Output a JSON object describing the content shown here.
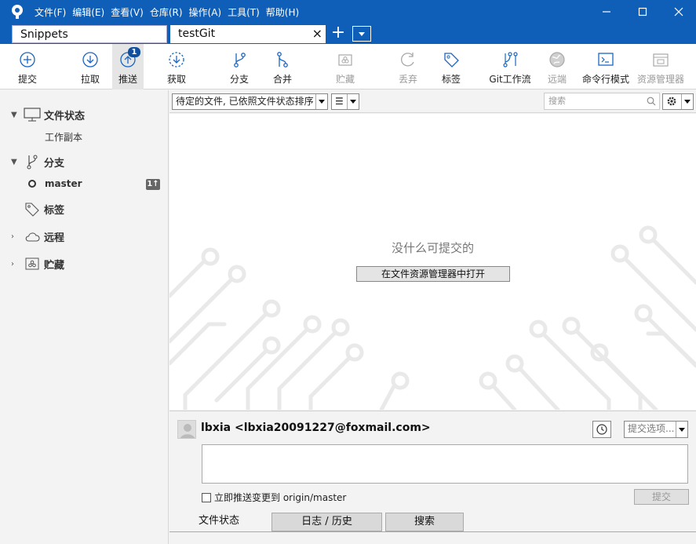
{
  "window": {
    "menus": [
      "文件(F)",
      "编辑(E)",
      "查看(V)",
      "仓库(R)",
      "操作(A)",
      "工具(T)",
      "帮助(H)"
    ]
  },
  "tabs": [
    {
      "label": "Snippets"
    },
    {
      "label": "testGit",
      "close": "×"
    }
  ],
  "tab_add": "+",
  "toolbar": {
    "buttons": [
      {
        "label": "提交",
        "icon": "commit-icon"
      },
      {
        "label": "拉取",
        "icon": "pull-icon"
      },
      {
        "label": "推送",
        "icon": "push-icon",
        "badge": "1"
      },
      {
        "label": "获取",
        "icon": "fetch-icon"
      },
      {
        "label": "分支",
        "icon": "branch-icon"
      },
      {
        "label": "合并",
        "icon": "merge-icon"
      },
      {
        "label": "贮藏",
        "icon": "stash-icon"
      },
      {
        "label": "丢弃",
        "icon": "discard-icon"
      },
      {
        "label": "标签",
        "icon": "tag-icon"
      },
      {
        "label": "Git工作流",
        "icon": "git-flow-icon"
      },
      {
        "label": "远端",
        "icon": "remote-icon"
      },
      {
        "label": "命令行模式",
        "icon": "terminal-icon"
      },
      {
        "label": "资源管理器",
        "icon": "explorer-icon"
      }
    ]
  },
  "sidebar": {
    "file_status": "文件状态",
    "working_copy": "工作副本",
    "branches": "分支",
    "current_branch": "master",
    "ahead_badge": "1↑",
    "tags": "标签",
    "remotes": "远程",
    "stashes": "贮藏"
  },
  "filter": {
    "sort_select": "待定的文件, 已依照文件状态排序",
    "view_select": "☰",
    "search_placeholder": "搜索"
  },
  "main": {
    "empty_message": "没什么可提交的",
    "open_explorer": "在文件资源管理器中打开"
  },
  "commit": {
    "author": "lbxia <lbxia20091227@foxmail.com>",
    "options_select": "提交选项...",
    "push_immediately": "立即推送变更到 origin/master",
    "commit_button": "提交"
  },
  "bottom_tabs": [
    "文件状态",
    "日志 / 历史",
    "搜索"
  ],
  "colors": {
    "accent": "#0f5fb8",
    "badge": "#0f4f9e"
  }
}
